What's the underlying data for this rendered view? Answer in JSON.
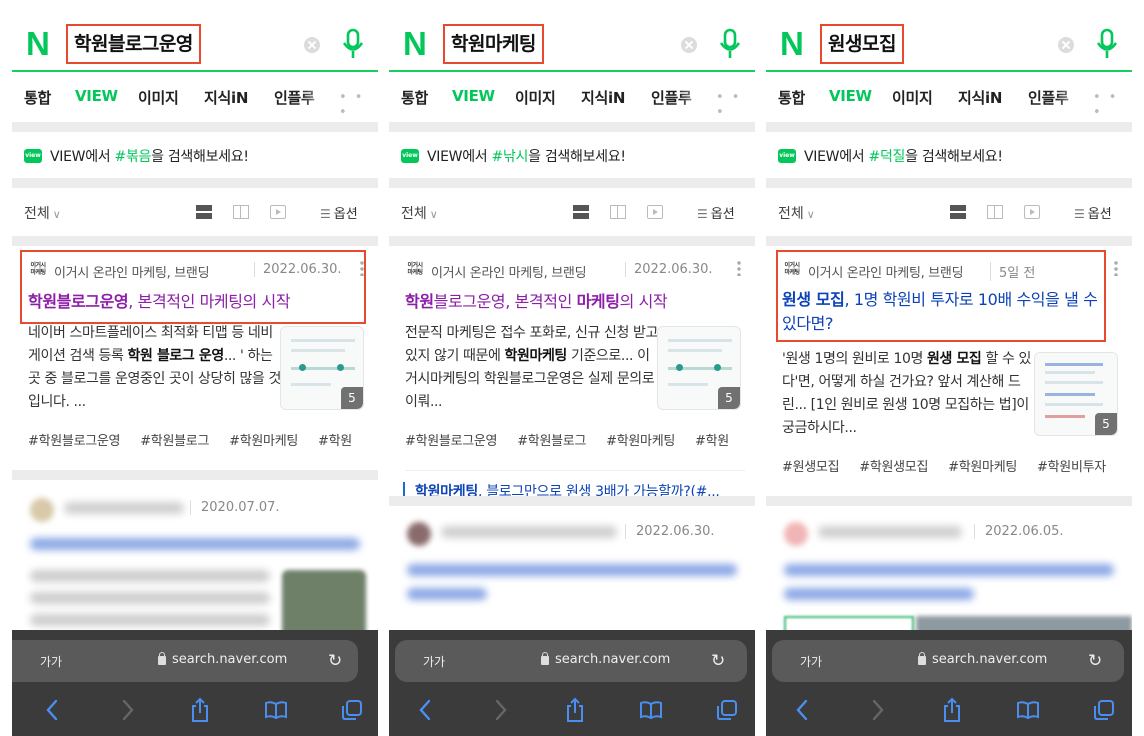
{
  "common": {
    "logo": "N",
    "tabs": [
      "통합",
      "VIEW",
      "이미지",
      "지식iN",
      "인플루"
    ],
    "more": "• • •",
    "suggest_prefix": "VIEW에서 ",
    "suggest_suffix": "을 검색해보세요!",
    "view_badge": "view",
    "filter_all": "전체",
    "filter_chevron": "∨",
    "options_label": "옵션",
    "source_thumb": "이거시 마케팅",
    "source_name": "이거시 온라인 마케팅, 브랜딩",
    "image_count": "5",
    "text_size": "가가",
    "url": "search.naver.com",
    "accent_color": "#03c75a",
    "highlight_color": "#e8492f"
  },
  "panels": [
    {
      "query": "학원블로그운영",
      "suggest_keyword": "#볶음",
      "date": "2022.06.30.",
      "title_bold": "학원블로그운영",
      "title_rest": ", 본격적인 마케팅의 시작",
      "snippet_parts": [
        "네이버 스마트플레이스 최적화 티맵 등 네비게이션 검색 등록 ",
        "학원 블로그 운영",
        "... ' 하는 곳 중 블로그를 운영중인 곳이 상당히 많을 것입니다. ..."
      ],
      "tags": [
        "#학원블로그운영",
        "#학원블로그",
        "#학원마케팅",
        "#학원"
      ],
      "blur_date": "2020.07.07."
    },
    {
      "query": "학원마케팅",
      "suggest_keyword": "#낚시",
      "date": "2022.06.30.",
      "title_bold": "학원",
      "title_mid": "블로그운영, 본격적인 ",
      "title_bold2": "마케팅",
      "title_rest": "의 시작",
      "snippet_parts": [
        "전문직 마케팅은 접수 포화로, 신규 신청 받고 있지 않기 때문에 ",
        "학원마케팅",
        " 기준으로... 이거시마케팅의 학원블로그운영은 실제 문의로 이뤄..."
      ],
      "tags": [
        "#학원블로그운영",
        "#학원블로그",
        "#학원마케팅",
        "#학원"
      ],
      "related_bold": "학원마케팅",
      "related_rest": ", 블로그만으로 원생 3배가 가능할까?(#...",
      "blur_date": "2022.06.30."
    },
    {
      "query": "원생모집",
      "suggest_keyword": "#덕질",
      "date": "5일 전",
      "title_bold": "원생 모집",
      "title_rest": ", 1명 학원비 투자로 10배 수익을 낼 수 있다면?",
      "snippet_parts": [
        "'원생 1명의 원비로 10명 ",
        "원생 모집",
        " 할 수 있다'면, 어떻게 하실 건가요? 앞서 계산해 드린... [1인 원비로 원생 10명 모집하는 법]이 궁금하시다..."
      ],
      "tags": [
        "#원생모집",
        "#학원생모집",
        "#학원마케팅",
        "#학원비투자"
      ],
      "blur_date": "2022.06.05."
    }
  ]
}
